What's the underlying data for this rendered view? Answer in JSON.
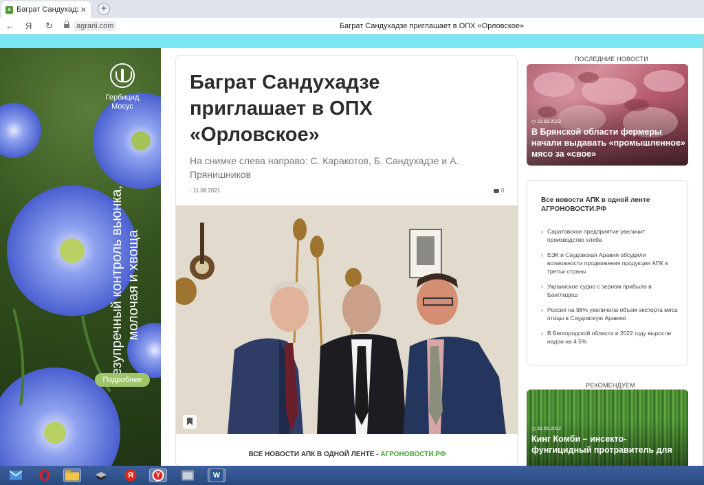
{
  "browser": {
    "tab": {
      "title": "Баграт Сандухадзе приглашает в",
      "close_glyph": "✕",
      "favicon_text": "А"
    },
    "new_tab_glyph": "+",
    "back_glyph": "←",
    "yandex_glyph": "Я",
    "reload_glyph": "↻",
    "domain": "agrarii.com",
    "page_title": "Баграт Сандухадзе приглашает в ОПХ «Орловское»"
  },
  "ad": {
    "brand": "Гербицид Мосус",
    "tagline": "Безупречный контроль вьюнка, молочая и хвоща",
    "button": "Подробнее"
  },
  "article": {
    "title": "Баграт Сандухадзе приглашает в ОПХ «Орловское»",
    "subtitle": "На снимке слева направо: С. Каракотов, Б. Сандухадзе и А. Прянишников",
    "date": "11.08.2021",
    "comments": "0",
    "all_news_prefix": "ВСЕ НОВОСТИ АПК В ОДНОЙ ЛЕНТЕ - ",
    "all_news_link": "АГРОНОВОСТИ.РФ"
  },
  "sidebar": {
    "latest_label": "ПОСЛЕДНИЕ НОВОСТИ",
    "latest_card": {
      "date": "19.09.2022",
      "title": "В Брянской области фермеры начали выдавать «промышленное» мясо за «свое»"
    },
    "feed": {
      "heading": "Все новости АПК в одной ленте АГРОНОВОСТИ.РФ",
      "items": [
        "Саратовское предприятие увеличит производство хлеба",
        "ЕЭК и Саудовская Аравия обсудили возможности продвижения продукции АПК в третьи страны",
        "Украинское судно с зерном прибыло в Бангладеш",
        "Россия на 98% увеличила объем экспорта мяса птицы в Саудовскую Аравию",
        "В Белгородской области в 2022 году выросли надои на 4.5%"
      ]
    },
    "recommend_label": "РЕКОМЕНДУЕМ",
    "promo_card": {
      "date": "31.05.2022",
      "title": "Кинг Комби – инсекто-фунгицидный протравитель для"
    }
  },
  "taskbar": {
    "yandex_glyph": "Я",
    "browser_glyph": "Y",
    "word_glyph": "W"
  },
  "colors": {
    "accent_green": "#43a52c",
    "cyan_strip": "#79e8f2",
    "ad_button": "#9fc56b"
  }
}
